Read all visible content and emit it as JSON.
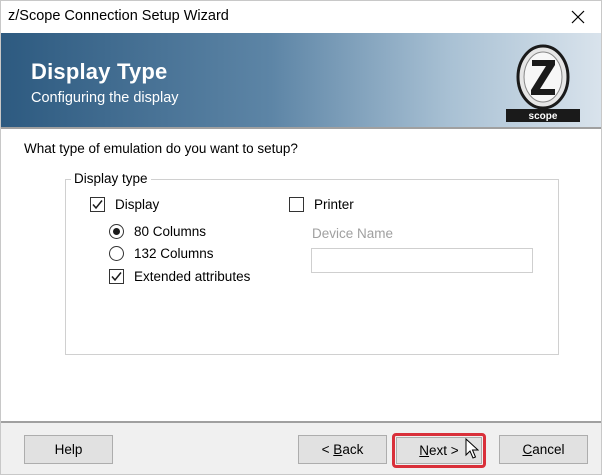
{
  "window": {
    "title": "z/Scope Connection Setup Wizard"
  },
  "banner": {
    "heading": "Display Type",
    "subheading": "Configuring the display",
    "logo_text": "scope"
  },
  "content": {
    "question": "What type of emulation do you want to setup?",
    "group_label": "Display type",
    "display_checkbox": {
      "label": "Display",
      "checked": true
    },
    "printer_checkbox": {
      "label": "Printer",
      "checked": false
    },
    "radio_80": {
      "label": "80 Columns",
      "selected": true
    },
    "radio_132": {
      "label": "132 Columns",
      "selected": false
    },
    "extended_checkbox": {
      "label": "Extended attributes",
      "checked": true
    },
    "device_name_label": "Device Name",
    "device_name_value": ""
  },
  "footer": {
    "help_label": "Help",
    "back_label_pre": "< ",
    "back_label_underlined": "B",
    "back_label_post": "ack",
    "next_label_underlined": "N",
    "next_label_post": "ext >",
    "cancel_label_underlined": "C",
    "cancel_label_post": "ancel"
  },
  "colors": {
    "banner_dark": "#2d5a80",
    "banner_light": "#d9e3ec",
    "highlight_red": "#d9303a"
  }
}
